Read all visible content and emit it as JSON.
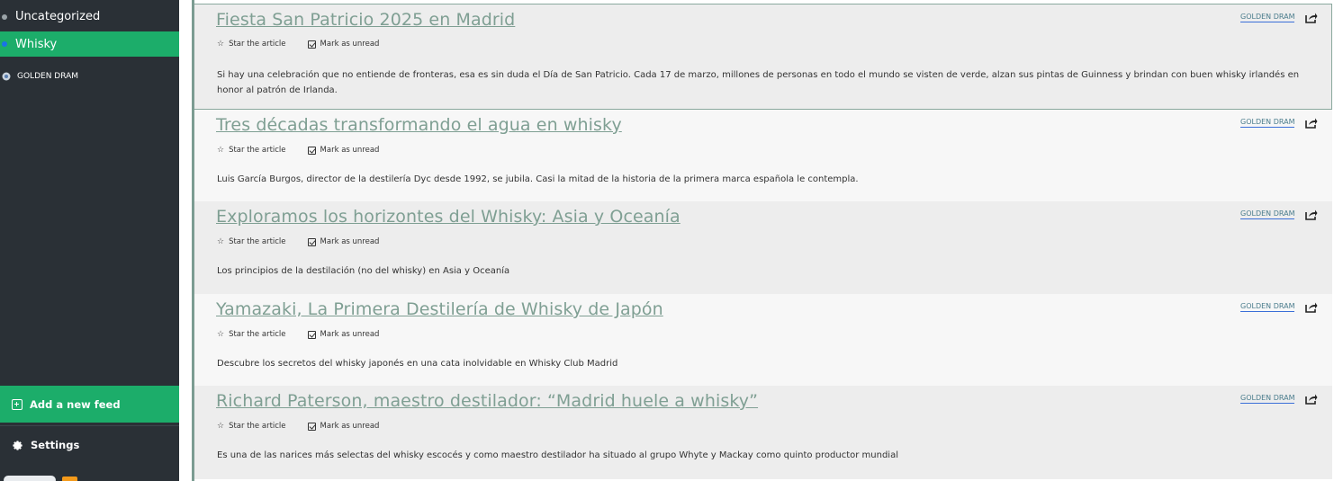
{
  "sidebar": {
    "categories": [
      {
        "label": "Uncategorized"
      },
      {
        "label": "Whisky"
      }
    ],
    "feed": {
      "label": "GOLDEN DRAM"
    },
    "add_feed_label": "Add a new feed",
    "settings_label": "Settings"
  },
  "articles": [
    {
      "title": "Fiesta San Patricio 2025 en Madrid",
      "star_label": "Star the article",
      "unread_label": "Mark as unread",
      "summary": "Si hay una celebración que no entiende de fronteras, esa es sin duda el Día de San Patricio. Cada 17 de marzo, millones de personas en todo el mundo se visten de verde, alzan sus pintas de Guinness y brindan con buen whisky irlandés en honor al patrón de Irlanda.",
      "source": "GOLDEN DRAM"
    },
    {
      "title": "Tres décadas transformando el agua en whisky",
      "star_label": "Star the article",
      "unread_label": "Mark as unread",
      "summary": "Luis García Burgos, director de la destilería Dyc desde 1992, se jubila. Casi la mitad de la historia de la primera marca española le contempla.",
      "source": "GOLDEN DRAM"
    },
    {
      "title": "Exploramos los horizontes del Whisky: Asia y Oceanía",
      "star_label": "Star the article",
      "unread_label": "Mark as unread",
      "summary": "Los principios de la destilación (no del whisky) en Asia y Oceanía",
      "source": "GOLDEN DRAM"
    },
    {
      "title": "Yamazaki, La Primera Destilería de Whisky de Japón",
      "star_label": "Star the article",
      "unread_label": "Mark as unread",
      "summary": "Descubre los secretos del whisky japonés en una cata inolvidable en Whisky Club Madrid",
      "source": "GOLDEN DRAM"
    },
    {
      "title": "Richard Paterson, maestro destilador: “Madrid huele a whisky”",
      "star_label": "Star the article",
      "unread_label": "Mark as unread",
      "summary": "Es una de las narices más selectas del whisky escocés y como maestro destilador ha situado al grupo Whyte y Mackay como quinto productor mundial",
      "source": "GOLDEN DRAM"
    }
  ],
  "colors": {
    "sidebar_bg": "#2a3036",
    "accent_green": "#1cad6a",
    "title_color": "#7f9f93",
    "selected_border": "#7c9c92"
  }
}
